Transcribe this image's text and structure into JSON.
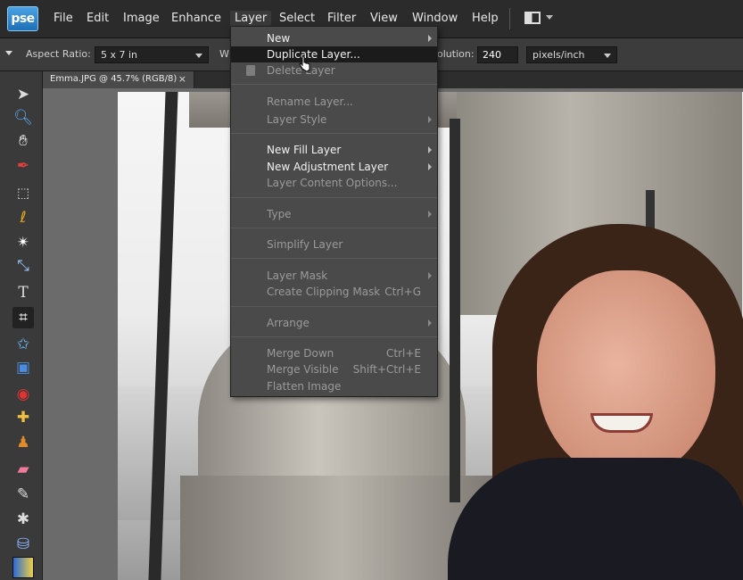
{
  "app": {
    "logo": "pse"
  },
  "menubar": {
    "items": [
      {
        "label": "File",
        "name": "menu-file"
      },
      {
        "label": "Edit",
        "name": "menu-edit"
      },
      {
        "label": "Image",
        "name": "menu-image"
      },
      {
        "label": "Enhance",
        "name": "menu-enhance"
      },
      {
        "label": "Layer",
        "name": "menu-layer",
        "active": true
      },
      {
        "label": "Select",
        "name": "menu-select"
      },
      {
        "label": "Filter",
        "name": "menu-filter"
      },
      {
        "label": "View",
        "name": "menu-view"
      },
      {
        "label": "Window",
        "name": "menu-window"
      },
      {
        "label": "Help",
        "name": "menu-help"
      }
    ]
  },
  "options": {
    "aspect_ratio_label": "Aspect Ratio:",
    "aspect_ratio_value": "5 x 7 in",
    "width_label": "W",
    "resolution_label": "olution:",
    "resolution_value": "240",
    "resolution_unit": "pixels/inch"
  },
  "document": {
    "tab_title": "Emma.JPG @ 45.7% (RGB/8)",
    "close": "×"
  },
  "layer_menu": {
    "groups": [
      [
        {
          "label": "New",
          "submenu": true,
          "enabled": true
        },
        {
          "label": "Duplicate Layer...",
          "enabled": true,
          "hover": true
        },
        {
          "label": "Delete Layer",
          "enabled": false,
          "icon": "trash-icon"
        }
      ],
      [
        {
          "label": "Rename Layer...",
          "enabled": false
        },
        {
          "label": "Layer Style",
          "submenu": true,
          "enabled": false
        }
      ],
      [
        {
          "label": "New Fill Layer",
          "submenu": true,
          "enabled": true
        },
        {
          "label": "New Adjustment Layer",
          "submenu": true,
          "enabled": true
        },
        {
          "label": "Layer Content Options...",
          "enabled": false
        }
      ],
      [
        {
          "label": "Type",
          "submenu": true,
          "enabled": false
        }
      ],
      [
        {
          "label": "Simplify Layer",
          "enabled": false
        }
      ],
      [
        {
          "label": "Layer Mask",
          "submenu": true,
          "enabled": false
        },
        {
          "label": "Create Clipping Mask",
          "shortcut": "Ctrl+G",
          "enabled": false
        }
      ],
      [
        {
          "label": "Arrange",
          "submenu": true,
          "enabled": false
        }
      ],
      [
        {
          "label": "Merge Down",
          "shortcut": "Ctrl+E",
          "enabled": false
        },
        {
          "label": "Merge Visible",
          "shortcut": "Shift+Ctrl+E",
          "enabled": false
        },
        {
          "label": "Flatten Image",
          "enabled": false
        }
      ]
    ]
  },
  "tools": [
    "move-tool-icon",
    "zoom-tool-icon",
    "hand-tool-icon",
    "eyedropper-tool-icon",
    "marquee-tool-icon",
    "lasso-tool-icon",
    "magic-wand-tool-icon",
    "quick-selection-tool-icon",
    "type-tool-icon",
    "crop-tool-icon",
    "cookie-cutter-tool-icon",
    "straighten-tool-icon",
    "red-eye-tool-icon",
    "spot-healing-tool-icon",
    "clone-stamp-tool-icon",
    "eraser-tool-icon",
    "brush-tool-icon",
    "smart-brush-tool-icon",
    "paint-bucket-tool-icon",
    "gradient-tool-icon"
  ],
  "colors": {
    "menu_bg": "#4a4a4a",
    "hover_bg": "#1b1b1b",
    "logo_blue": "#2f8fd8"
  }
}
